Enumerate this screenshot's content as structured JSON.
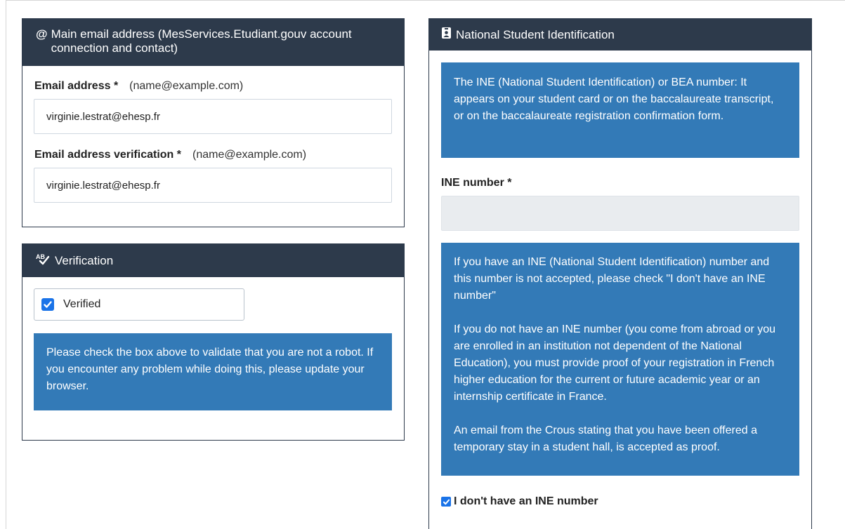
{
  "email_card": {
    "icon": "@",
    "title": "Main email address (MesServices.Etudiant.gouv account connection and contact)",
    "email_label": "Email address *",
    "email_hint": "(name@example.com)",
    "email_value": "virginie.lestrat@ehesp.fr",
    "verify_label": "Email address verification *",
    "verify_hint": "(name@example.com)",
    "verify_value": "virginie.lestrat@ehesp.fr"
  },
  "verification_card": {
    "icon": "spellcheck-icon",
    "title": "Verification",
    "checkbox_label": "Verified",
    "checkbox_checked": true,
    "info": "Please check the box above to validate that you are not a robot. If you encounter any problem while doing this, please update your browser."
  },
  "ine_card": {
    "icon": "id-badge-icon",
    "title": "National Student Identification",
    "info_top": "The INE (National Student Identification) or BEA number: It appears on your student card or on the baccalaureate transcript, or on the baccalaureate registration confirmation form.",
    "ine_label": "INE number *",
    "ine_value": "",
    "info_p1": "If you have an INE (National Student Identification) number and this number is not accepted, please check \"I don't have an INE number\"",
    "info_p2": "If you do not have an INE number (you come from abroad or you are enrolled in an institution not dependent of the National Education), you must provide proof of your registration in French higher education for the current or future academic year or an internship certificate in France.",
    "info_p3": "An email from the Crous stating that you have been offered a temporary stay in a student hall, is accepted as proof.",
    "no_ine_label": "I don't have an INE number",
    "no_ine_checked": true
  },
  "colors": {
    "header_bg": "#2d3a4b",
    "info_bg": "#337ab7",
    "check_blue": "#1a73e8"
  }
}
